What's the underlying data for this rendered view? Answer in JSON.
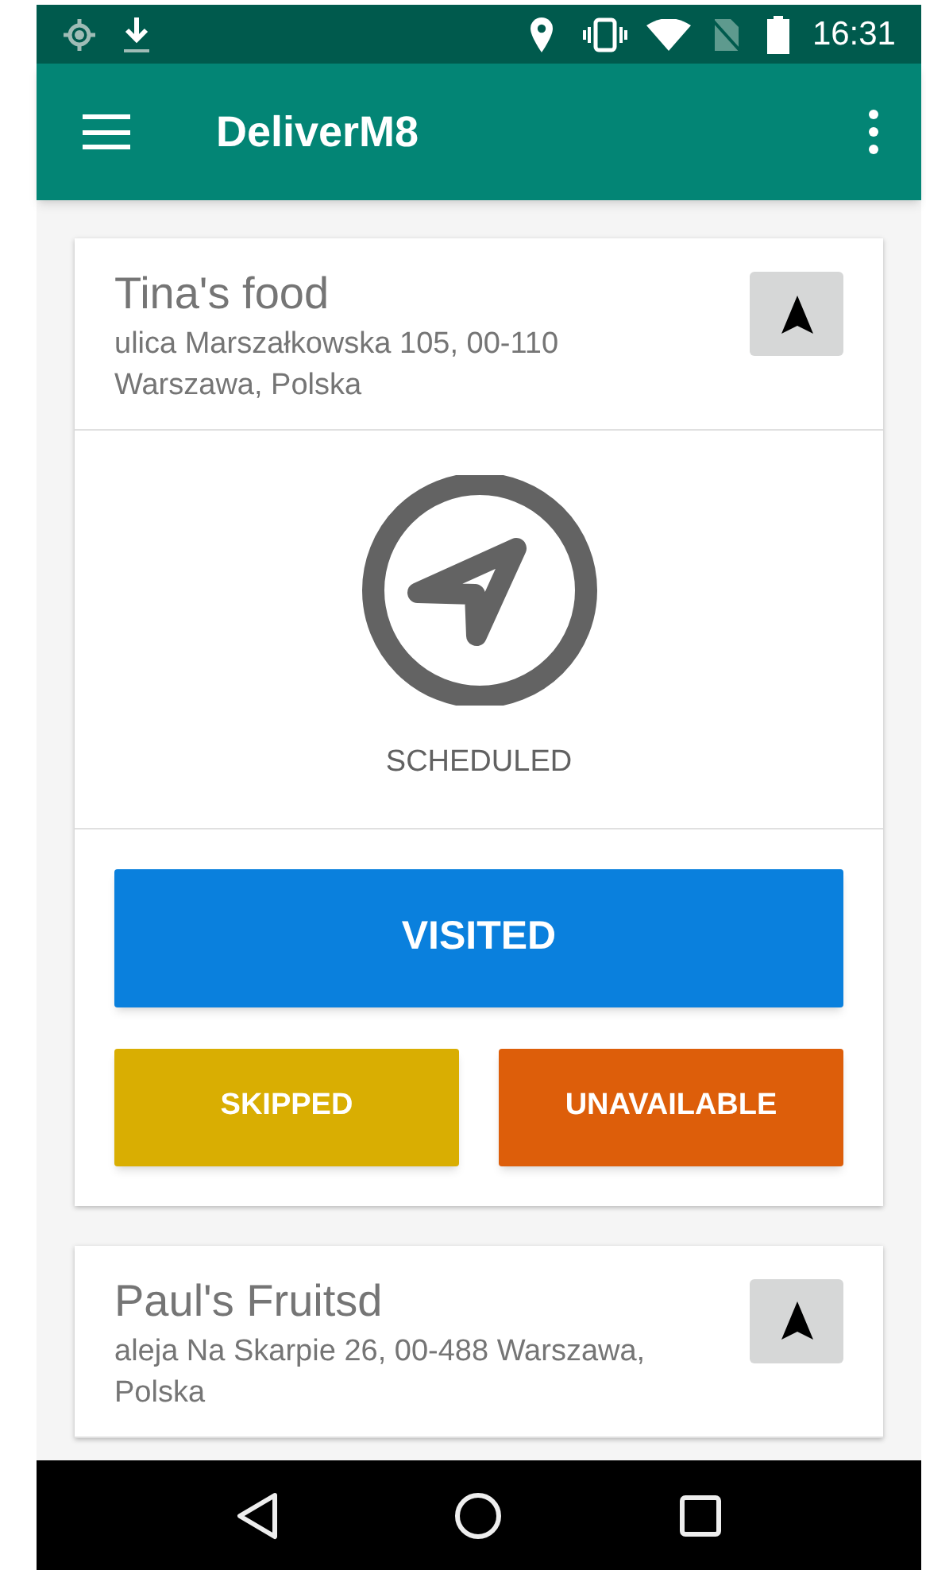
{
  "status_bar": {
    "time": "16:31"
  },
  "app_bar": {
    "title": "DeliverM8"
  },
  "deliveries": [
    {
      "name": "Tina's food",
      "address": "ulica Marszałkowska 105, 00-110 Warszawa, Polska",
      "status": "SCHEDULED",
      "actions": [
        {
          "label": "VISITED",
          "kind": "primary",
          "color": "#0a80dd"
        },
        {
          "label": "SKIPPED",
          "kind": "secondary",
          "color": "#d9ae02"
        },
        {
          "label": "UNAVAILABLE",
          "kind": "secondary",
          "color": "#dd5e0a"
        }
      ]
    },
    {
      "name": "Paul's Fruitsd",
      "address": "aleja Na Skarpie 26, 00-488 Warszawa, Polska"
    }
  ]
}
